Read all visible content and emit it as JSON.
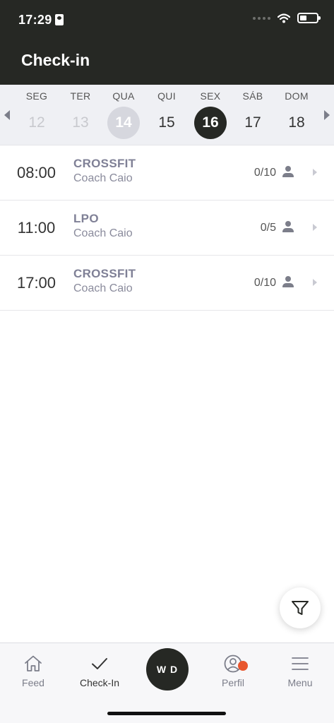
{
  "status_bar": {
    "time": "17:29"
  },
  "header": {
    "title": "Check-in"
  },
  "calendar": {
    "days": [
      {
        "name": "SEG",
        "number": "12",
        "state": "past"
      },
      {
        "name": "TER",
        "number": "13",
        "state": "past"
      },
      {
        "name": "QUA",
        "number": "14",
        "state": "today"
      },
      {
        "name": "QUI",
        "number": "15",
        "state": "normal"
      },
      {
        "name": "SEX",
        "number": "16",
        "state": "selected"
      },
      {
        "name": "SÁB",
        "number": "17",
        "state": "normal"
      },
      {
        "name": "DOM",
        "number": "18",
        "state": "normal"
      }
    ]
  },
  "classes": [
    {
      "time": "08:00",
      "name": "CROSSFIT",
      "coach": "Coach Caio",
      "count": "0/10"
    },
    {
      "time": "11:00",
      "name": "LPO",
      "coach": "Coach Caio",
      "count": "0/5"
    },
    {
      "time": "17:00",
      "name": "CROSSFIT",
      "coach": "Coach Caio",
      "count": "0/10"
    }
  ],
  "tab_bar": {
    "feed": "Feed",
    "checkin": "Check-In",
    "wod": "W D",
    "perfil": "Perfil",
    "menu": "Menu"
  },
  "colors": {
    "header_bg": "#262824",
    "accent_notification": "#e8562e",
    "class_name": "#7f8096"
  }
}
